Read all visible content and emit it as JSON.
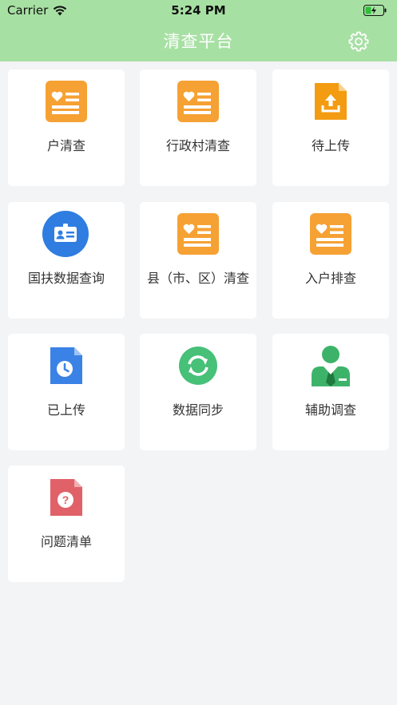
{
  "status_bar": {
    "carrier": "Carrier",
    "time": "5:24 PM"
  },
  "header": {
    "title": "清查平台",
    "settings_icon": "gear-icon"
  },
  "colors": {
    "header_bg": "#a7e0a3",
    "page_bg": "#f3f4f6",
    "card_bg": "#ffffff",
    "orange": "#f6a133",
    "blue": "#3b82e6",
    "green": "#47c078",
    "red": "#e06167"
  },
  "grid": {
    "items": [
      {
        "label": "户清查",
        "icon": "id-card-icon"
      },
      {
        "label": "行政村清查",
        "icon": "id-card-icon"
      },
      {
        "label": "待上传",
        "icon": "upload-file-icon"
      },
      {
        "label": "国扶数据查询",
        "icon": "badge-icon"
      },
      {
        "label": "县（市、区）清查",
        "icon": "id-card-icon"
      },
      {
        "label": "入户排查",
        "icon": "id-card-icon"
      },
      {
        "label": "已上传",
        "icon": "clock-file-icon"
      },
      {
        "label": "数据同步",
        "icon": "sync-icon"
      },
      {
        "label": "辅助调查",
        "icon": "person-icon"
      },
      {
        "label": "问题清单",
        "icon": "question-file-icon"
      }
    ]
  }
}
